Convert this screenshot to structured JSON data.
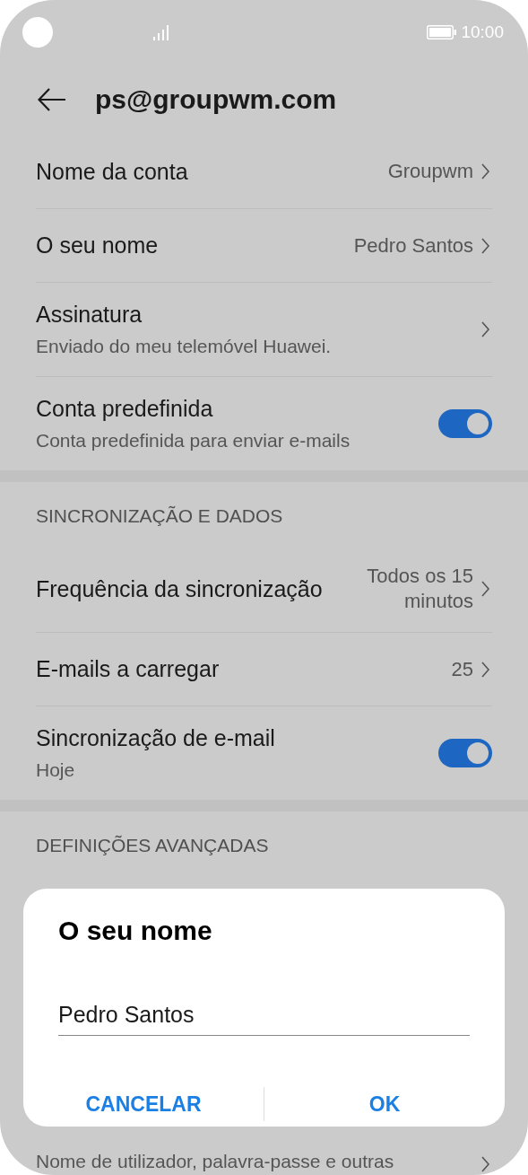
{
  "status_bar": {
    "time": "10:00"
  },
  "header": {
    "title": "ps@groupwm.com"
  },
  "sections": [
    {
      "items": [
        {
          "kind": "value",
          "title": "Nome da conta",
          "value": "Groupwm"
        },
        {
          "kind": "value",
          "title": "O seu nome",
          "value": "Pedro Santos"
        },
        {
          "kind": "link",
          "title": "Assinatura",
          "subtitle": "Enviado do meu telemóvel Huawei."
        },
        {
          "kind": "toggle",
          "title": "Conta predefinida",
          "subtitle": "Conta predefinida para enviar e-mails",
          "on": true
        }
      ]
    },
    {
      "header": "SINCRONIZAÇÃO E DADOS",
      "items": [
        {
          "kind": "value",
          "title": "Frequência da sincronização",
          "value": "Todos os 15 minutos"
        },
        {
          "kind": "value",
          "title": "E-mails a carregar",
          "value": "25"
        },
        {
          "kind": "toggle",
          "title": "Sincronização de e-mail",
          "subtitle": "Hoje",
          "on": true
        }
      ]
    },
    {
      "header": "DEFINIÇÕES AVANÇADAS",
      "items": [
        {
          "kind": "link",
          "subtitle": "Nome de utilizador, palavra-passe e outras"
        }
      ]
    }
  ],
  "dialog": {
    "title": "O seu nome",
    "value": "Pedro Santos",
    "buttons": [
      "CANCELAR",
      "OK"
    ]
  }
}
